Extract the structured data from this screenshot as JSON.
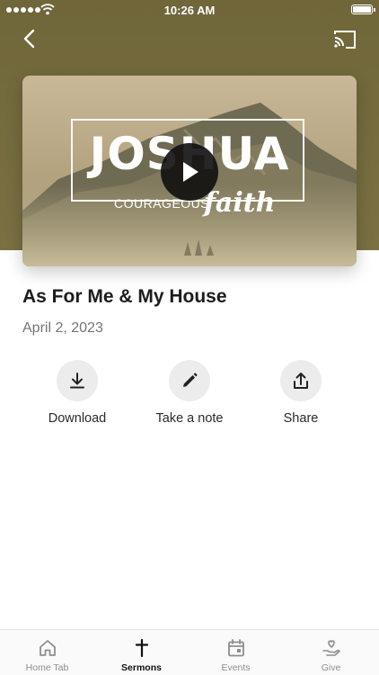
{
  "status_bar": {
    "time": "10:26 AM"
  },
  "nav": {
    "back_icon": "chevron-left-icon",
    "cast_icon": "cast-icon"
  },
  "video": {
    "art_title": "JOSHUA",
    "art_subtitle": "COURAGEOUS",
    "art_script": "faith",
    "play_icon": "play-icon"
  },
  "sermon": {
    "title": "As For Me & My House",
    "date": "April 2, 2023"
  },
  "actions": [
    {
      "label": "Download",
      "icon": "download-icon"
    },
    {
      "label": "Take a note",
      "icon": "pencil-icon"
    },
    {
      "label": "Share",
      "icon": "share-icon"
    }
  ],
  "tabs": [
    {
      "label": "Home Tab",
      "icon": "home-icon",
      "active": false
    },
    {
      "label": "Sermons",
      "icon": "cross-icon",
      "active": true
    },
    {
      "label": "Events",
      "icon": "calendar-icon",
      "active": false
    },
    {
      "label": "Give",
      "icon": "hand-heart-icon",
      "active": false
    }
  ],
  "colors": {
    "header_bg": "#736a3e",
    "action_circle": "#ececec",
    "tab_active": "#111111",
    "tab_inactive": "#8e8e8e"
  }
}
